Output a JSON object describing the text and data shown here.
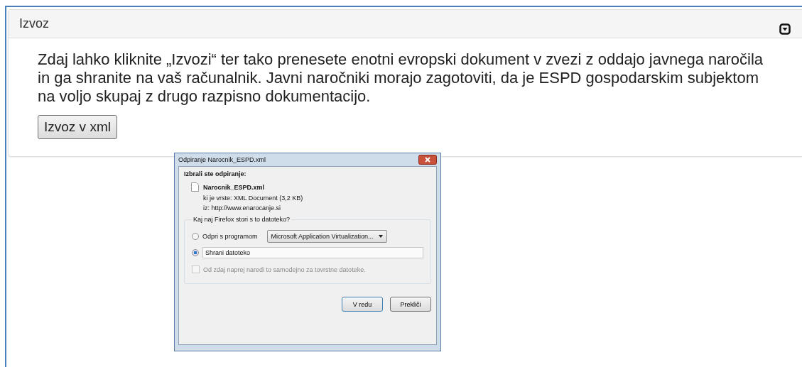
{
  "panel": {
    "title": "Izvoz",
    "expanded": true
  },
  "body": {
    "text": "Zdaj lahko kliknite „Izvozi“ ter tako prenesete enotni evropski dokument v zvezi z oddajo javnega naročila in ga shranite na vaš računalnik. Javni naročniki morajo zagotoviti, da je ESPD gospodarskim subjektom na voljo skupaj z drugo razpisno dokumentacijo.",
    "button": "Izvoz v xml"
  },
  "dialog": {
    "title": "Odpiranje Narocnik_ESPD.xml",
    "intro": "Izbrali ste odpiranje:",
    "file_name": "Narocnik_ESPD.xml",
    "file_type": "ki je vrste:  XML Document (3,2 KB)",
    "source": "iz:  http://www.enarocanje.si",
    "question": "Kaj naj Firefox stori s to datoteko?",
    "options": [
      {
        "label": "Odpri s programom",
        "selected": false,
        "program": "Microsoft Application Virtualization..."
      },
      {
        "label": "Shrani datoteko",
        "selected": true
      }
    ],
    "remember": {
      "label": "Od zdaj naprej naredi to samodejno za tovrstne datoteke.",
      "checked": false,
      "disabled": true
    },
    "buttons": [
      "V redu",
      "Prekliči"
    ]
  }
}
